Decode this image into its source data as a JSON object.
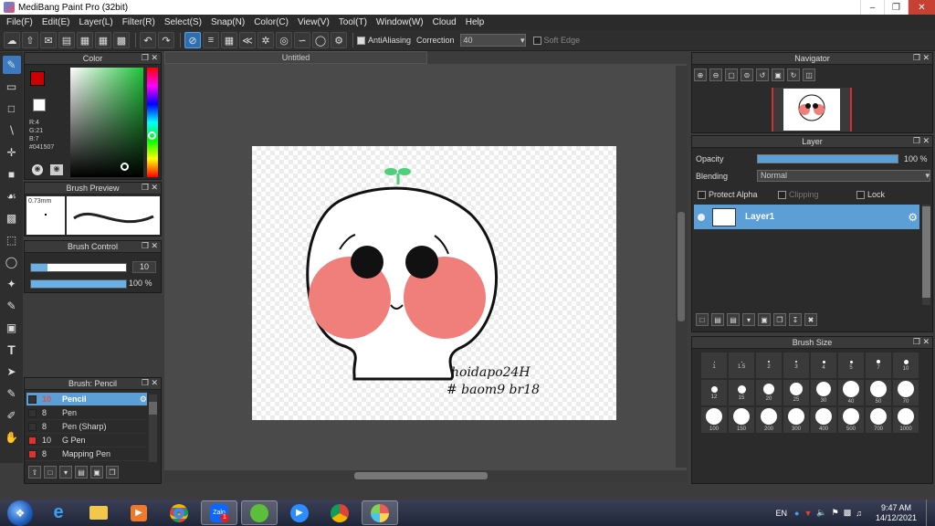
{
  "window": {
    "title": "MediBang Paint Pro (32bit)"
  },
  "menu": [
    "File(F)",
    "Edit(E)",
    "Layer(L)",
    "Filter(R)",
    "Select(S)",
    "Snap(N)",
    "Color(C)",
    "View(V)",
    "Tool(T)",
    "Window(W)",
    "Cloud",
    "Help"
  ],
  "toolbar": {
    "antialias_label": "AntiAliasing",
    "correction_label": "Correction",
    "correction_value": "40",
    "soft_edge_label": "Soft Edge"
  },
  "color_panel": {
    "title": "Color",
    "r": "R:4",
    "g": "G:21",
    "b": "B:7",
    "hex": "#041507"
  },
  "brush_preview": {
    "title": "Brush Preview",
    "size": "0.73mm"
  },
  "brush_control": {
    "title": "Brush Control",
    "size": "10",
    "opacity": "100 %"
  },
  "brush_list": {
    "title": "Brush: Pencil",
    "items": [
      {
        "num": "10",
        "name": "Pencil",
        "color": "#333333"
      },
      {
        "num": "8",
        "name": "Pen",
        "color": "#333333"
      },
      {
        "num": "8",
        "name": "Pen (Sharp)",
        "color": "#333333"
      },
      {
        "num": "10",
        "name": "G Pen",
        "color": "#e03030"
      },
      {
        "num": "8",
        "name": "Mapping Pen",
        "color": "#e03030"
      }
    ]
  },
  "document": {
    "tab": "Untitled"
  },
  "artwork": {
    "signature_line1": "hoidapo24H",
    "signature_line2": "# baom9 br18"
  },
  "navigator": {
    "title": "Navigator"
  },
  "layer_panel": {
    "title": "Layer",
    "opacity_label": "Opacity",
    "opacity_value": "100 %",
    "opacity": 1.0,
    "blending_label": "Blending",
    "blending_value": "Normal",
    "protect_alpha": "Protect Alpha",
    "clipping": "Clipping",
    "lock": "Lock",
    "layer_name": "Layer1"
  },
  "brush_size": {
    "title": "Brush Size",
    "sizes": [
      "1",
      "1.5",
      "2",
      "3",
      "4",
      "5",
      "7",
      "10",
      "12",
      "15",
      "20",
      "25",
      "30",
      "40",
      "50",
      "70",
      "100",
      "150",
      "200",
      "300",
      "400",
      "500",
      "700",
      "1000"
    ]
  },
  "taskbar": {
    "lang": "EN",
    "time": "9:47 AM",
    "date": "14/12/2021",
    "zalo_badge": "1"
  }
}
